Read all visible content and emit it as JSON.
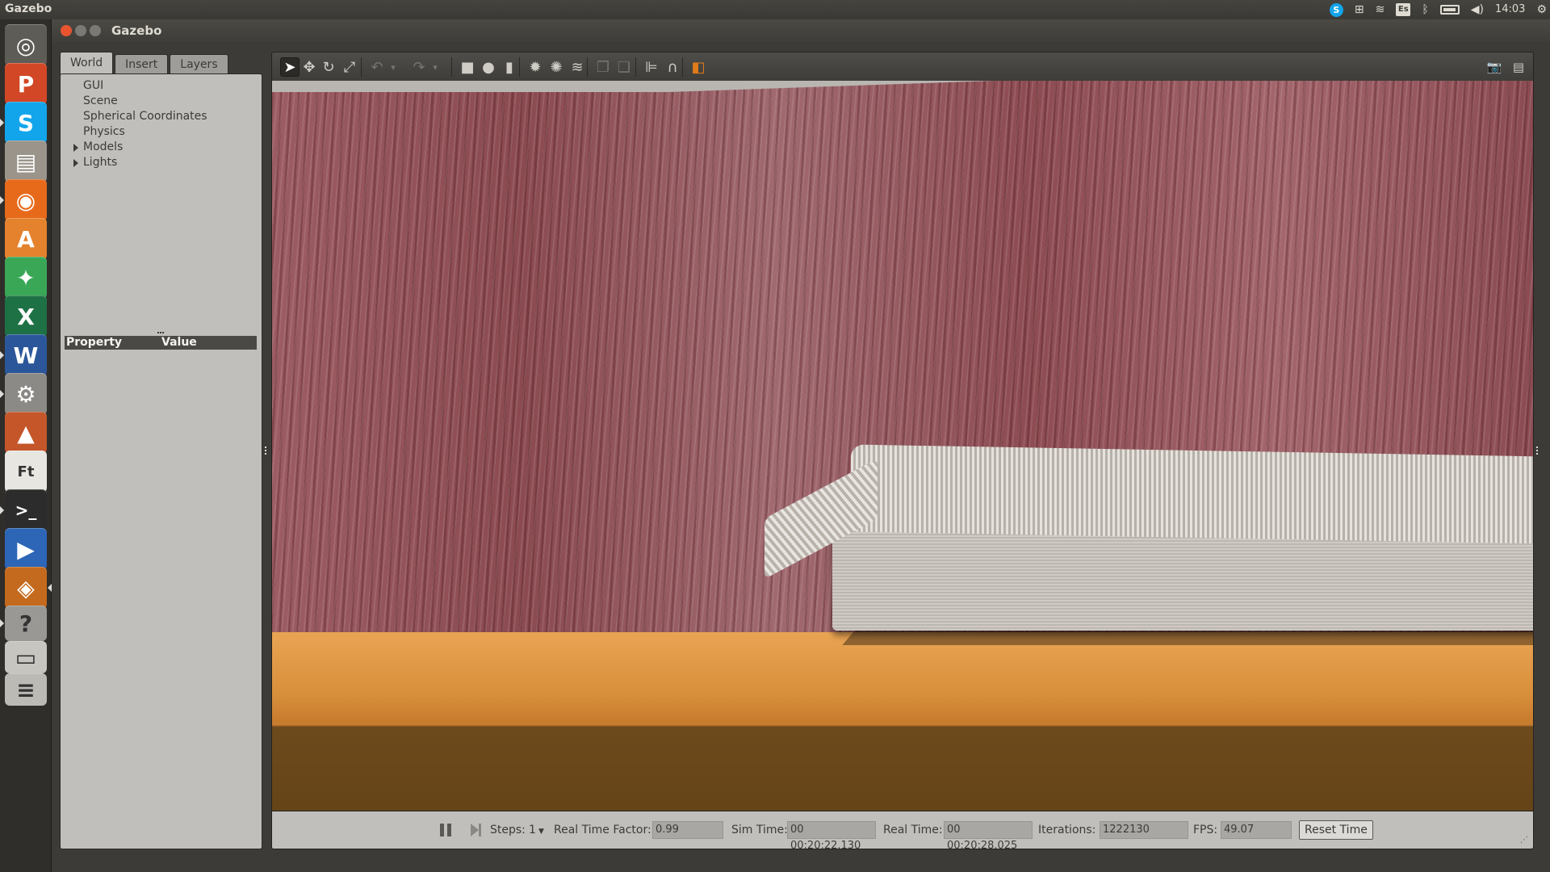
{
  "panel": {
    "app_name": "Gazebo",
    "clock": "14:03",
    "keyboard_layout": "Es",
    "tray_icons": [
      "skype-icon",
      "workspaces-icon",
      "wifi-icon",
      "keyboard-icon",
      "bluetooth-icon",
      "battery-icon",
      "volume-icon",
      "clock",
      "settings-icon"
    ]
  },
  "launcher": {
    "items": [
      {
        "name": "dash-home",
        "glyph": "◎",
        "color": "#5e5c57"
      },
      {
        "name": "powerpoint",
        "glyph": "P",
        "color": "#d24726"
      },
      {
        "name": "skype",
        "glyph": "S",
        "color": "#12a5ec"
      },
      {
        "name": "files",
        "glyph": "▤",
        "color": "#9a948a"
      },
      {
        "name": "firefox",
        "glyph": "◉",
        "color": "#e76a1b"
      },
      {
        "name": "software-center",
        "glyph": "A",
        "color": "#e4822d"
      },
      {
        "name": "pinwheel-app",
        "glyph": "✦",
        "color": "#3aa757"
      },
      {
        "name": "excel",
        "glyph": "X",
        "color": "#1e7145"
      },
      {
        "name": "word",
        "glyph": "W",
        "color": "#2b579a"
      },
      {
        "name": "system-settings",
        "glyph": "⚙",
        "color": "#8c8a86"
      },
      {
        "name": "matlab",
        "glyph": "▲",
        "color": "#c4562a"
      },
      {
        "name": "font-editor",
        "glyph": "Ft",
        "color": "#e8e6e1"
      },
      {
        "name": "terminal",
        "glyph": ">_",
        "color": "#2c2c2c"
      },
      {
        "name": "media-player",
        "glyph": "▶",
        "color": "#2d66b6"
      },
      {
        "name": "gazebo",
        "glyph": "◈",
        "color": "#c46a1e"
      },
      {
        "name": "help",
        "glyph": "?",
        "color": "#9a9894"
      },
      {
        "name": "drive",
        "glyph": "▭",
        "color": "#c7c5c0"
      },
      {
        "name": "trash",
        "glyph": "≡",
        "color": "#bcbab5"
      }
    ]
  },
  "window": {
    "title": "Gazebo"
  },
  "left_panel": {
    "tabs": [
      "World",
      "Insert",
      "Layers"
    ],
    "active_tab": "World",
    "tree": [
      {
        "label": "GUI",
        "expandable": false
      },
      {
        "label": "Scene",
        "expandable": false
      },
      {
        "label": "Spherical Coordinates",
        "expandable": false
      },
      {
        "label": "Physics",
        "expandable": false
      },
      {
        "label": "Models",
        "expandable": true
      },
      {
        "label": "Lights",
        "expandable": true
      }
    ],
    "property_header": {
      "property": "Property",
      "value": "Value"
    }
  },
  "toolbar": {
    "tools": [
      {
        "name": "select-mode",
        "glyph": "➤",
        "state": "selected"
      },
      {
        "name": "translate-mode",
        "glyph": "✥",
        "state": "normal"
      },
      {
        "name": "rotate-mode",
        "glyph": "↻",
        "state": "normal"
      },
      {
        "name": "scale-mode",
        "glyph": "⤢",
        "state": "normal"
      },
      {
        "name": "undo",
        "glyph": "↶",
        "state": "dim"
      },
      {
        "name": "undo-history",
        "glyph": "▾",
        "state": "dim"
      },
      {
        "name": "redo",
        "glyph": "↷",
        "state": "dim"
      },
      {
        "name": "redo-history",
        "glyph": "▾",
        "state": "dim"
      },
      {
        "name": "box-shape",
        "glyph": "■",
        "state": "normal"
      },
      {
        "name": "sphere-shape",
        "glyph": "●",
        "state": "normal"
      },
      {
        "name": "cylinder-shape",
        "glyph": "▮",
        "state": "normal"
      },
      {
        "name": "point-light",
        "glyph": "✹",
        "state": "normal"
      },
      {
        "name": "spot-light",
        "glyph": "✺",
        "state": "normal"
      },
      {
        "name": "directional-light",
        "glyph": "≋",
        "state": "normal"
      },
      {
        "name": "copy",
        "glyph": "❐",
        "state": "dim"
      },
      {
        "name": "paste",
        "glyph": "❏",
        "state": "dim"
      },
      {
        "name": "align",
        "glyph": "⊫",
        "state": "normal"
      },
      {
        "name": "snap",
        "glyph": "∩",
        "state": "normal"
      },
      {
        "name": "change-view",
        "glyph": "◧",
        "state": "normal"
      }
    ],
    "right_tools": [
      {
        "name": "screenshot",
        "glyph": "📷"
      },
      {
        "name": "log-data",
        "glyph": "▤"
      }
    ]
  },
  "sim_bar": {
    "steps_label": "Steps:",
    "steps_value": "1",
    "rtf_label": "Real Time Factor:",
    "rtf_value": "0.99",
    "sim_time_label": "Sim Time:",
    "sim_time_value": "00 00:20:22.130",
    "real_time_label": "Real Time:",
    "real_time_value": "00 00:20:28.025",
    "iterations_label": "Iterations:",
    "iterations_value": "1222130",
    "fps_label": "FPS:",
    "fps_value": "49.07",
    "reset_label": "Reset Time"
  }
}
